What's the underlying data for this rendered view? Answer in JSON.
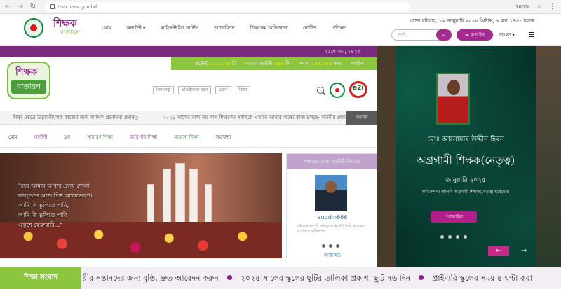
{
  "browser": {
    "url": "teachers.gov.bd",
    "zoom": "160%"
  },
  "header": {
    "brand_line1": "শিক্ষক",
    "brand_line2": "বাতায়ন",
    "nav": [
      "হোম",
      "কনটেন্ট",
      "লাইফস্টাইল সার্ভিস",
      "অ্যাডমিশন",
      "শিক্ষাক্রম অভিজ্ঞতা",
      "নোটিশ",
      "প্রশিক্ষণ"
    ],
    "date": "রোজ রবিবার, ১৯ জানুয়ারি ২০২৫ খ্রিষ্টাব্দ, ৬ মাঘ ১৪৩১ বঙ্গাব্দ",
    "search_placeholder": "সার্চ...",
    "login_label": "লগ ইন",
    "language": "বাংলা"
  },
  "embedded": {
    "date_strip": "২১শে মাঘ, ১৪২৩",
    "stats": [
      {
        "label": "কন্টেন্ট",
        "value": "১০০,০২৮",
        "unit": "টি"
      },
      {
        "label": "মডেল কন্টেন্ট",
        "value": "৬৪৪",
        "unit": "টি"
      },
      {
        "label": "সদস্য",
        "value": "১৪৫,৪৪৪",
        "unit": "জন"
      }
    ],
    "login": "লগইন",
    "logo_line1": "শিক্ষক",
    "logo_line2": "বাতায়ন",
    "filters": [
      "বিষয়বস্তু",
      "প্রতিষ্ঠানের ধরন",
      "শ্রেণি",
      "বিষয়"
    ],
    "a2i": "a2i",
    "ticker_left": "শিক্ষা ক্ষেত্রে উদ্ভাবনীমূলক কাজের জন্য আর্থিক প্রণোদনা প্রদান",
    "ticker_right": "২০২১ সালের মধ্যে নয় লাখ শিক্ষকের সবাইকে এখানে আনার লক্ষ্যে কাজ চলছে- মাননীয় প্রধান",
    "news_button": "সংবাদ",
    "subnav": [
      "হোম",
      "কন্টেন্ট",
      "ব্লগ",
      "সাধারণ শিক্ষা",
      "কারিগরি শিক্ষা",
      "মাদ্রাসা শিক্ষা",
      "সহায়তা"
    ],
    "hero_quote": [
      "\"হবে আমার আবার প্রলয় দোলা,",
      "ফাল্গুনে আজ চিত্ত আত্মভোলা।",
      "আমি কি ভুলিতে পারি,",
      "আমি কি ভুলিতে পারি",
      "একুশে ফেব্রুয়ারি...\""
    ],
    "card_header": "সপ্তাহের সেরা কন্টেন্ট নির্মাতা",
    "card_username": "auddin666",
    "card_desc": "মাইলেক্স আপনি মানবতুল্য কন্টেন্ট তৈরি করেছেন, আপনাকে অভিনন্দন",
    "card_archive": "আর্কাইভ"
  },
  "banner": {
    "name": "মোঃ আনোয়ার উদ্দীন হিরন",
    "title": "অগ্রগামী শিক্ষক(নেতৃত্ব)",
    "month": "জানুয়ারি ২০২৫",
    "congrats": "অভিনন্দন! আপনি অগ্রগামী শিক্ষক(নেতৃত্ব) হয়েছেন।",
    "profile_button": "প্রোফাইল",
    "prev_icon": "←",
    "next_icon": "→"
  },
  "news_ticker": {
    "label": "শিক্ষা সংবাদ",
    "items": [
      "রীর সন্তানদের জন্য বৃত্তি, দ্রুত আবেদন করুন",
      "২০২৫ সালের স্কুলের ছুটির তালিকা প্রকাশ, ছুটি ৭৬ দিন",
      "প্রাইমারি স্কুলের সময় ৫ ঘণ্টা করা"
    ]
  },
  "colors": {
    "purple": "#a32a8f",
    "green": "#8cc63f",
    "banner_bg": "#06322a"
  }
}
